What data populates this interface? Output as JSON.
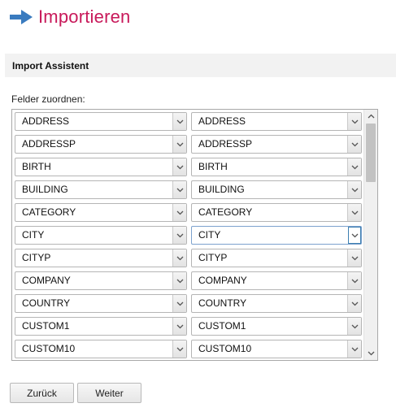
{
  "header": {
    "title": "Importieren",
    "icon": "arrow-right-icon",
    "accent_color": "#c8195a",
    "icon_color": "#3a7bbf"
  },
  "section": {
    "title": "Import Assistent"
  },
  "mapping": {
    "label": "Felder zuordnen:",
    "rows": [
      {
        "source": "ADDRESS",
        "target": "ADDRESS"
      },
      {
        "source": "ADDRESSP",
        "target": "ADDRESSP"
      },
      {
        "source": "BIRTH",
        "target": "BIRTH"
      },
      {
        "source": "BUILDING",
        "target": "BUILDING"
      },
      {
        "source": "CATEGORY",
        "target": "CATEGORY"
      },
      {
        "source": "CITY",
        "target": "CITY",
        "focused": true
      },
      {
        "source": "CITYP",
        "target": "CITYP"
      },
      {
        "source": "COMPANY",
        "target": "COMPANY"
      },
      {
        "source": "COUNTRY",
        "target": "COUNTRY"
      },
      {
        "source": "CUSTOM1",
        "target": "CUSTOM1"
      },
      {
        "source": "CUSTOM10",
        "target": "CUSTOM10"
      }
    ]
  },
  "footer": {
    "back_label": "Zurück",
    "next_label": "Weiter"
  }
}
